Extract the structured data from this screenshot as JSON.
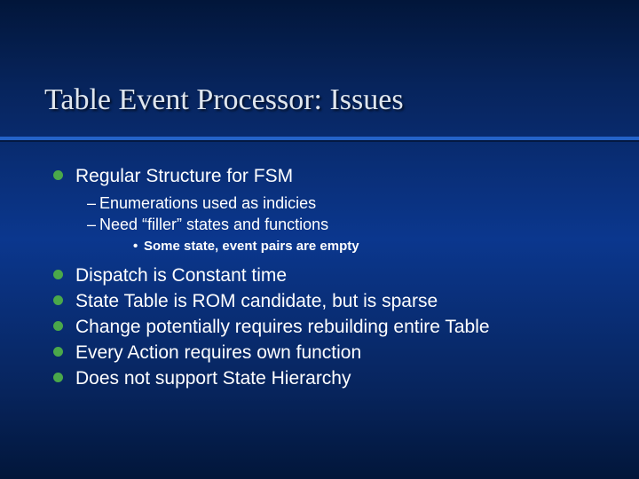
{
  "title": "Table Event Processor: Issues",
  "bullets": {
    "b0": {
      "text": "Regular Structure for FSM",
      "sub": {
        "s0": "Enumerations used as indicies",
        "s1": "Need “filler” states and functions",
        "note": "Some state, event pairs are empty"
      }
    },
    "b1": "Dispatch is Constant time",
    "b2": "State Table is ROM candidate, but is sparse",
    "b3": "Change potentially requires rebuilding entire Table",
    "b4": "Every Action requires own function",
    "b5": "Does not support State Hierarchy"
  }
}
